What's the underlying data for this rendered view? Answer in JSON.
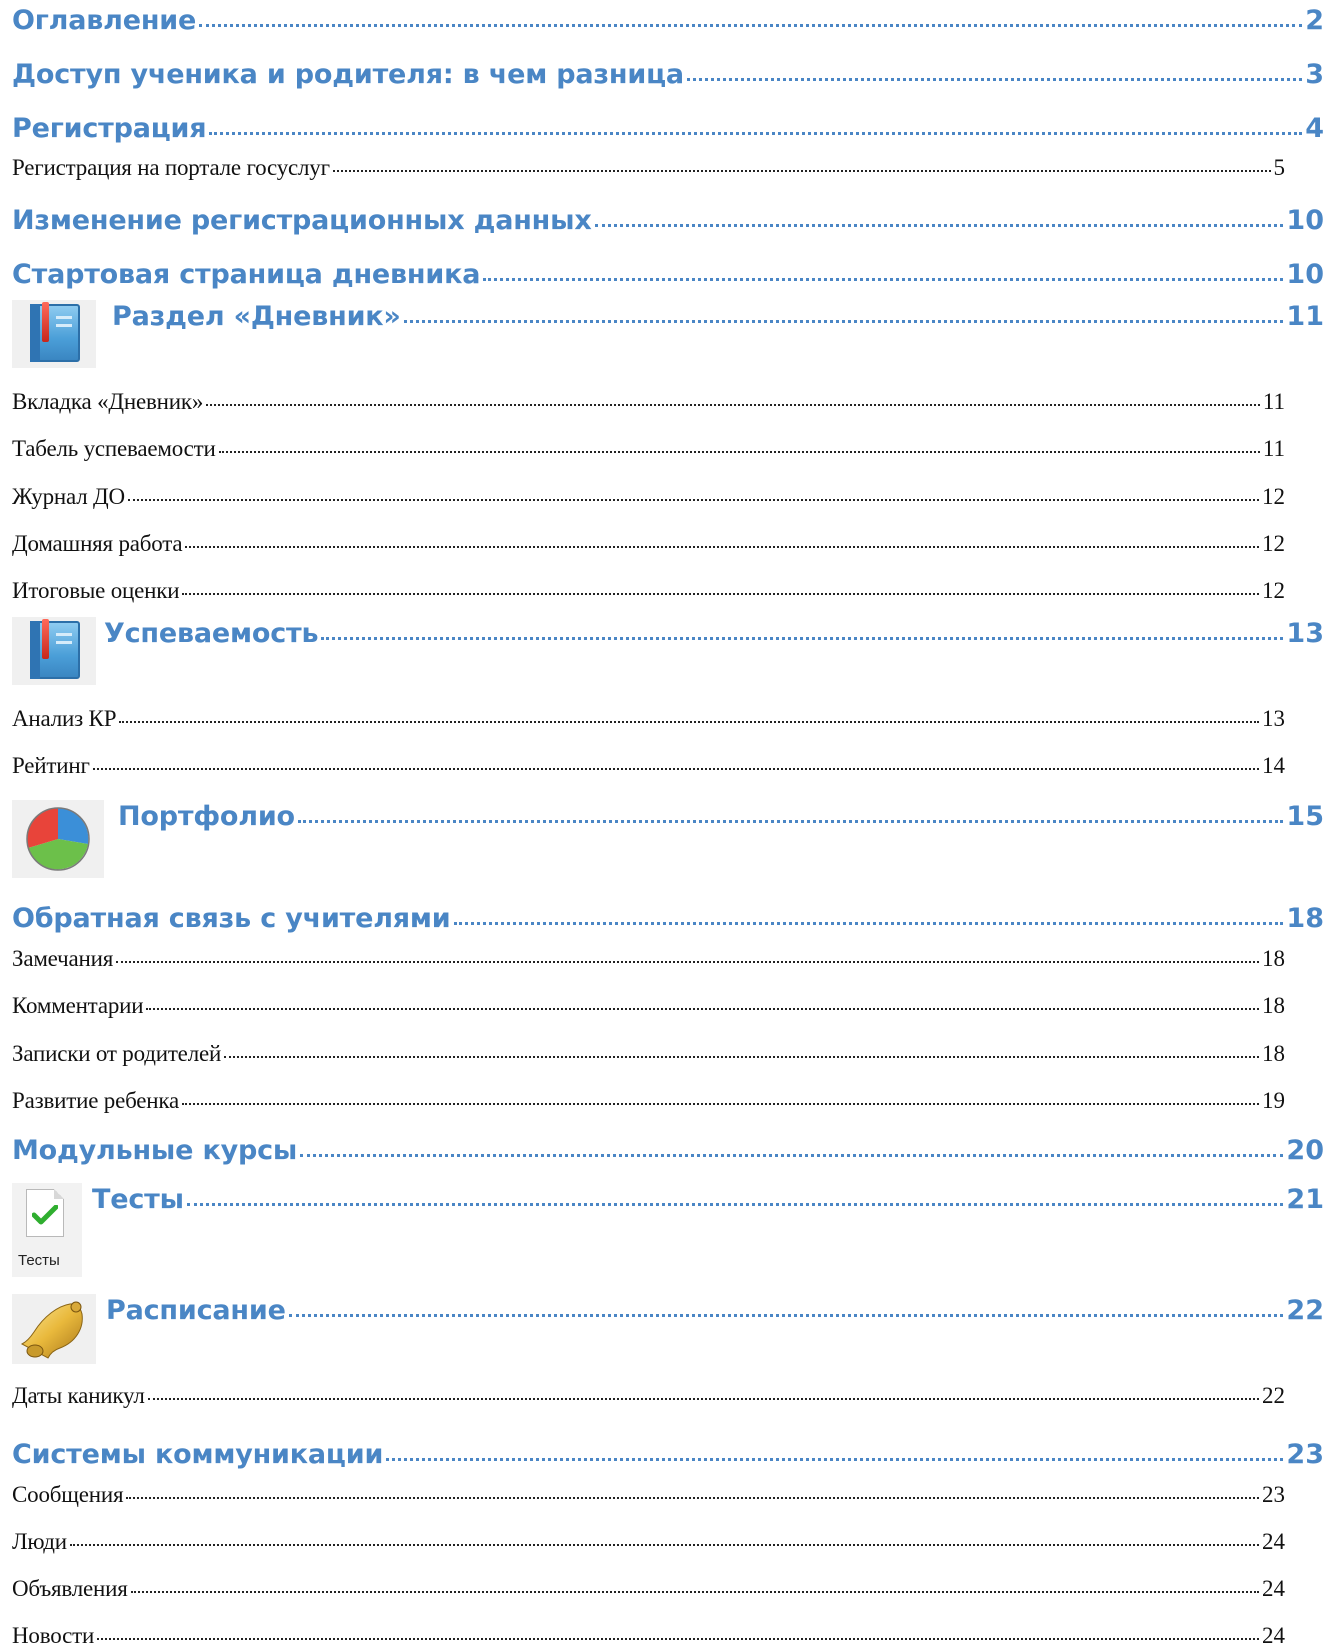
{
  "toc": {
    "entries": [
      {
        "title": "Оглавление",
        "page": "2"
      },
      {
        "title": "Доступ ученика и родителя: в чем разница",
        "page": "3"
      },
      {
        "title": "Регистрация",
        "page": "4"
      },
      {
        "title": "Регистрация на портале госуслуг",
        "page": "5"
      },
      {
        "title": "Изменение регистрационных данных",
        "page": "10"
      },
      {
        "title": "Стартовая страница дневника",
        "page": "10"
      },
      {
        "title": "Раздел «Дневник»",
        "page": "11",
        "icon": "book-icon"
      },
      {
        "title": "Вкладка «Дневник»",
        "page": "11"
      },
      {
        "title": "Табель успеваемости",
        "page": "11"
      },
      {
        "title": "Журнал ДО",
        "page": "12"
      },
      {
        "title": "Домашняя работа",
        "page": "12"
      },
      {
        "title": "Итоговые оценки",
        "page": "12"
      },
      {
        "title": "Успеваемость",
        "page": "13",
        "icon": "book-icon"
      },
      {
        "title": "Анализ КР",
        "page": "13"
      },
      {
        "title": "Рейтинг",
        "page": "14"
      },
      {
        "title": "Портфолио",
        "page": "15",
        "icon": "pie-chart-icon"
      },
      {
        "title": "Обратная связь с учителями",
        "page": "18"
      },
      {
        "title": "Замечания",
        "page": "18"
      },
      {
        "title": "Комментарии",
        "page": "18"
      },
      {
        "title": "Записки от родителей",
        "page": "18"
      },
      {
        "title": "Развитие ребенка",
        "page": "19"
      },
      {
        "title": "Модульные курсы",
        "page": "20"
      },
      {
        "title": "Тесты",
        "page": "21",
        "icon": "tests-icon",
        "icon_caption": "Тесты"
      },
      {
        "title": "Расписание",
        "page": "22",
        "icon": "bell-icon"
      },
      {
        "title": "Даты каникул",
        "page": "22"
      },
      {
        "title": "Системы коммуникации",
        "page": "23"
      },
      {
        "title": "Сообщения",
        "page": "23"
      },
      {
        "title": "Люди",
        "page": "24"
      },
      {
        "title": "Объявления",
        "page": "24"
      },
      {
        "title": "Новости",
        "page": "24"
      }
    ]
  },
  "colors": {
    "heading": "#4a86c5",
    "subentry": "#111111",
    "background": "#ffffff"
  }
}
